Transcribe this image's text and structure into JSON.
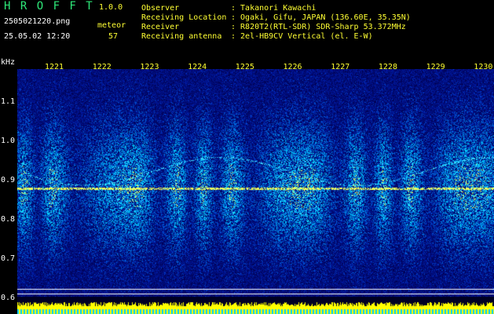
{
  "header": {
    "app_name": "H R O F F T",
    "version": "1.0.0",
    "filename": "2505021220.png",
    "datetime": "25.05.02 12:20",
    "meteor_label": "meteor",
    "meteor_count": "57"
  },
  "station": {
    "rows": [
      {
        "key": "Observer",
        "value": ": Takanori Kawachi"
      },
      {
        "key": "Receiving Location",
        "value": ": Ogaki, Gifu, JAPAN (136.60E, 35.35N)"
      },
      {
        "key": "Receiver",
        "value": ": R820T2(RTL-SDR) SDR-Sharp 53.372MHz"
      },
      {
        "key": "Receiving antenna",
        "value": ": 2el-HB9CV Vertical (el. E-W)"
      }
    ]
  },
  "spectrogram": {
    "y_unit": "kHz",
    "x_ticks": [
      "1221",
      "1222",
      "1223",
      "1224",
      "1225",
      "1226",
      "1227",
      "1228",
      "1229",
      "1230"
    ],
    "y_ticks": [
      "1.1",
      "1.0",
      "0.9",
      "0.8",
      "0.7",
      "0.6"
    ],
    "colors": {
      "low": "#000088",
      "mid": "#0066ff",
      "high": "#33ccff",
      "peak": "#ffff33",
      "level": "#ffff00",
      "level_base": "#00ccff"
    }
  }
}
